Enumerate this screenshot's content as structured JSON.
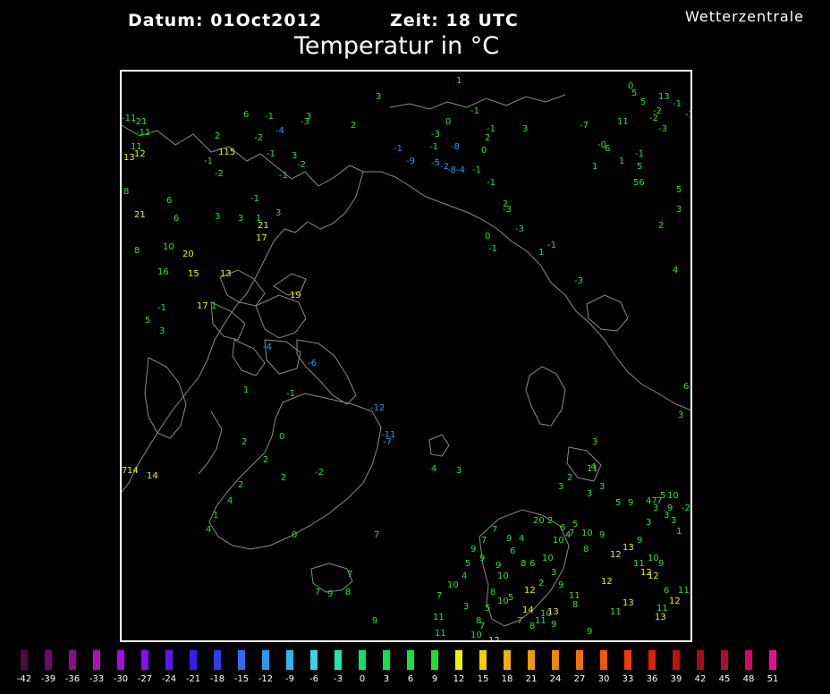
{
  "header": {
    "datum": "Datum: 01Oct2012",
    "zeit": "Zeit: 18 UTC",
    "title": "Temperatur in °C",
    "brand": "Wetterzentrale"
  },
  "map_labels": [
    {
      "t": "-11",
      "c": "g"
    },
    {
      "t": "-21",
      "c": "g"
    },
    {
      "t": "-11",
      "c": "g"
    },
    {
      "t": "11",
      "c": "g"
    },
    {
      "t": "13",
      "c": "y"
    },
    {
      "t": "12",
      "c": "y"
    },
    {
      "t": "6",
      "c": "g"
    },
    {
      "t": "-1",
      "c": "g"
    },
    {
      "t": "2",
      "c": "g"
    },
    {
      "t": "-1",
      "c": "g"
    },
    {
      "t": "115",
      "c": "y"
    },
    {
      "t": "-4",
      "c": "b"
    },
    {
      "t": "-2",
      "c": "g"
    },
    {
      "t": "-1",
      "c": "g"
    },
    {
      "t": "-2",
      "c": "g"
    },
    {
      "t": "-3",
      "c": "g"
    },
    {
      "t": "3",
      "c": "g"
    },
    {
      "t": "-2",
      "c": "g"
    },
    {
      "t": "-1",
      "c": "g"
    },
    {
      "t": "3",
      "c": "g"
    },
    {
      "t": "8",
      "c": "g"
    },
    {
      "t": "6",
      "c": "g"
    },
    {
      "t": "21",
      "c": "y"
    },
    {
      "t": "6",
      "c": "g"
    },
    {
      "t": "3",
      "c": "g"
    },
    {
      "t": "3",
      "c": "g"
    },
    {
      "t": "1",
      "c": "g"
    },
    {
      "t": "3",
      "c": "g"
    },
    {
      "t": "-1",
      "c": "g"
    },
    {
      "t": "21",
      "c": "y"
    },
    {
      "t": "17",
      "c": "y"
    },
    {
      "t": "8",
      "c": "g"
    },
    {
      "t": "10",
      "c": "g"
    },
    {
      "t": "20",
      "c": "y"
    },
    {
      "t": "16",
      "c": "g"
    },
    {
      "t": "15",
      "c": "y"
    },
    {
      "t": "13",
      "c": "y"
    },
    {
      "t": "17",
      "c": "y"
    },
    {
      "t": "1",
      "c": "g"
    },
    {
      "t": "19",
      "c": "y"
    },
    {
      "t": "-1",
      "c": "g"
    },
    {
      "t": "5",
      "c": "g"
    },
    {
      "t": "3",
      "c": "g"
    },
    {
      "t": "-4",
      "c": "b"
    },
    {
      "t": "-6",
      "c": "b"
    },
    {
      "t": "1",
      "c": "g"
    },
    {
      "t": "-1",
      "c": "g"
    },
    {
      "t": "-12",
      "c": "b"
    },
    {
      "t": "-11",
      "c": "b"
    },
    {
      "t": "-7",
      "c": "b"
    },
    {
      "t": "0",
      "c": "g"
    },
    {
      "t": "2",
      "c": "g"
    },
    {
      "t": "2",
      "c": "g"
    },
    {
      "t": "-2",
      "c": "g"
    },
    {
      "t": "2",
      "c": "g"
    },
    {
      "t": "4",
      "c": "g"
    },
    {
      "t": "3",
      "c": "g"
    },
    {
      "t": "14",
      "c": "y"
    },
    {
      "t": "7",
      "c": "y"
    },
    {
      "t": "14",
      "c": "y"
    },
    {
      "t": "2",
      "c": "g"
    },
    {
      "t": "4",
      "c": "g"
    },
    {
      "t": "1",
      "c": "g"
    },
    {
      "t": "4",
      "c": "g"
    },
    {
      "t": "0",
      "c": "g"
    },
    {
      "t": "7",
      "c": "g"
    },
    {
      "t": "7",
      "c": "g"
    },
    {
      "t": "9",
      "c": "g"
    },
    {
      "t": "8",
      "c": "g"
    },
    {
      "t": "7",
      "c": "g"
    },
    {
      "t": "9",
      "c": "g"
    },
    {
      "t": "3",
      "c": "g"
    },
    {
      "t": "2",
      "c": "g"
    },
    {
      "t": "-1",
      "c": "g"
    },
    {
      "t": "0",
      "c": "g"
    },
    {
      "t": "-3",
      "c": "g"
    },
    {
      "t": "2",
      "c": "g"
    },
    {
      "t": "-8",
      "c": "b"
    },
    {
      "t": "0",
      "c": "g"
    },
    {
      "t": "-1",
      "c": "b"
    },
    {
      "t": "-9",
      "c": "b"
    },
    {
      "t": "-5",
      "c": "b"
    },
    {
      "t": "-2",
      "c": "b"
    },
    {
      "t": "-8",
      "c": "b"
    },
    {
      "t": "-4",
      "c": "b"
    },
    {
      "t": "-1",
      "c": "g"
    },
    {
      "t": "-1",
      "c": "g"
    },
    {
      "t": "3",
      "c": "g"
    },
    {
      "t": "1",
      "c": "g"
    },
    {
      "t": "-1",
      "c": "g"
    },
    {
      "t": "-1",
      "c": "g"
    },
    {
      "t": "2",
      "c": "g"
    },
    {
      "t": "-3",
      "c": "g"
    },
    {
      "t": "-3",
      "c": "g"
    },
    {
      "t": "0",
      "c": "g"
    },
    {
      "t": "-1",
      "c": "g"
    },
    {
      "t": "-1",
      "c": "g"
    },
    {
      "t": "1",
      "c": "g"
    },
    {
      "t": "-3",
      "c": "g"
    },
    {
      "t": "0",
      "c": "g"
    },
    {
      "t": "5",
      "c": "g"
    },
    {
      "t": "13",
      "c": "g"
    },
    {
      "t": "-2",
      "c": "g"
    },
    {
      "t": "-3",
      "c": "g"
    },
    {
      "t": "5",
      "c": "g"
    },
    {
      "t": "-7",
      "c": "g"
    },
    {
      "t": "11",
      "c": "g"
    },
    {
      "t": "-2",
      "c": "g"
    },
    {
      "t": "-1",
      "c": "g"
    },
    {
      "t": "-0",
      "c": "g"
    },
    {
      "t": "6",
      "c": "g"
    },
    {
      "t": "-1",
      "c": "g"
    },
    {
      "t": "1",
      "c": "g"
    },
    {
      "t": "5",
      "c": "g"
    },
    {
      "t": "1",
      "c": "g"
    },
    {
      "t": "56",
      "c": "g"
    },
    {
      "t": "5",
      "c": "g"
    },
    {
      "t": "3",
      "c": "g"
    },
    {
      "t": "2",
      "c": "g"
    },
    {
      "t": "-1",
      "c": "g"
    },
    {
      "t": "4",
      "c": "g"
    },
    {
      "t": "6",
      "c": "g"
    },
    {
      "t": "3",
      "c": "g"
    },
    {
      "t": "11",
      "c": "g"
    },
    {
      "t": "4",
      "c": "g"
    },
    {
      "t": "3",
      "c": "g"
    },
    {
      "t": "3",
      "c": "g"
    },
    {
      "t": "2",
      "c": "g"
    },
    {
      "t": "3",
      "c": "g"
    },
    {
      "t": "3",
      "c": "g"
    },
    {
      "t": "5",
      "c": "g"
    },
    {
      "t": "9",
      "c": "g"
    },
    {
      "t": "47",
      "c": "g"
    },
    {
      "t": "3",
      "c": "g"
    },
    {
      "t": "5",
      "c": "g"
    },
    {
      "t": "3",
      "c": "g"
    },
    {
      "t": "9",
      "c": "g"
    },
    {
      "t": "10",
      "c": "g"
    },
    {
      "t": "7",
      "c": "g"
    },
    {
      "t": "9",
      "c": "g"
    },
    {
      "t": "-2",
      "c": "g"
    },
    {
      "t": "3",
      "c": "g"
    },
    {
      "t": "3",
      "c": "g"
    },
    {
      "t": "1",
      "c": "g"
    },
    {
      "t": "20",
      "c": "g"
    },
    {
      "t": "2",
      "c": "g"
    },
    {
      "t": "6",
      "c": "g"
    },
    {
      "t": "5",
      "c": "g"
    },
    {
      "t": "4",
      "c": "g"
    },
    {
      "t": "10",
      "c": "g"
    },
    {
      "t": "7",
      "c": "g"
    },
    {
      "t": "10",
      "c": "g"
    },
    {
      "t": "8",
      "c": "g"
    },
    {
      "t": "9",
      "c": "g"
    },
    {
      "t": "12",
      "c": "y"
    },
    {
      "t": "13",
      "c": "y"
    },
    {
      "t": "11",
      "c": "g"
    },
    {
      "t": "12",
      "c": "y"
    },
    {
      "t": "10",
      "c": "g"
    },
    {
      "t": "9",
      "c": "g"
    },
    {
      "t": "6",
      "c": "g"
    },
    {
      "t": "11",
      "c": "g"
    },
    {
      "t": "12",
      "c": "y"
    },
    {
      "t": "13",
      "c": "y"
    },
    {
      "t": "12",
      "c": "y"
    },
    {
      "t": "11",
      "c": "g"
    },
    {
      "t": "12",
      "c": "y"
    },
    {
      "t": "12",
      "c": "y"
    },
    {
      "t": "14",
      "c": "y"
    },
    {
      "t": "10",
      "c": "g"
    },
    {
      "t": "13",
      "c": "y"
    },
    {
      "t": "11",
      "c": "g"
    },
    {
      "t": "9",
      "c": "g"
    },
    {
      "t": "8",
      "c": "g"
    },
    {
      "t": "11",
      "c": "g"
    },
    {
      "t": "10",
      "c": "g"
    },
    {
      "t": "7",
      "c": "g"
    },
    {
      "t": "7",
      "c": "g"
    },
    {
      "t": "5",
      "c": "g"
    },
    {
      "t": "4",
      "c": "g"
    },
    {
      "t": "10",
      "c": "g"
    },
    {
      "t": "7",
      "c": "g"
    },
    {
      "t": "3",
      "c": "g"
    },
    {
      "t": "8",
      "c": "g"
    },
    {
      "t": "5",
      "c": "g"
    },
    {
      "t": "8",
      "c": "g"
    },
    {
      "t": "10",
      "c": "g"
    },
    {
      "t": "9",
      "c": "g"
    },
    {
      "t": "5",
      "c": "g"
    },
    {
      "t": "9",
      "c": "g"
    },
    {
      "t": "6",
      "c": "g"
    },
    {
      "t": "8",
      "c": "g"
    },
    {
      "t": "7",
      "c": "g"
    },
    {
      "t": "9",
      "c": "g"
    },
    {
      "t": "4",
      "c": "g"
    },
    {
      "t": "7",
      "c": "g"
    },
    {
      "t": "9",
      "c": "g"
    },
    {
      "t": "10",
      "c": "g"
    },
    {
      "t": "3",
      "c": "g"
    },
    {
      "t": "2",
      "c": "g"
    },
    {
      "t": "6",
      "c": "g"
    },
    {
      "t": "9",
      "c": "g"
    },
    {
      "t": "11",
      "c": "g"
    },
    {
      "t": "8",
      "c": "g"
    },
    {
      "t": "11",
      "c": "g"
    },
    {
      "t": "10",
      "c": "g"
    },
    {
      "t": "12",
      "c": "y"
    },
    {
      "t": "9",
      "c": "g"
    },
    {
      "t": "11",
      "c": "g"
    },
    {
      "t": "13",
      "c": "y"
    }
  ],
  "legend": {
    "labels": [
      "-42",
      "-39",
      "-36",
      "-33",
      "-30",
      "-27",
      "-24",
      "-21",
      "-18",
      "-15",
      "-12",
      "-9",
      "-6",
      "-3",
      "0",
      "3",
      "6",
      "9",
      "12",
      "15",
      "18",
      "21",
      "24",
      "27",
      "30",
      "33",
      "36",
      "39",
      "42",
      "45",
      "48",
      "51"
    ],
    "colors": [
      "#4b0d48",
      "#6b0b6c",
      "#8f0a8f",
      "#b40fb4",
      "#a30fe0",
      "#7d12f0",
      "#5c16f5",
      "#3c1af5",
      "#2e3de8",
      "#2b6ef0",
      "#2b98f0",
      "#2fb8f0",
      "#36d8e8",
      "#20e6b0",
      "#10e070",
      "#12e050",
      "#18e038",
      "#20e020",
      "#f0f000",
      "#f0d000",
      "#f0b000",
      "#f09800",
      "#f08800",
      "#f07000",
      "#f05800",
      "#e84000",
      "#e02000",
      "#c01010",
      "#a00c18",
      "#b00a38",
      "#d00a60",
      "#f00a90"
    ]
  }
}
